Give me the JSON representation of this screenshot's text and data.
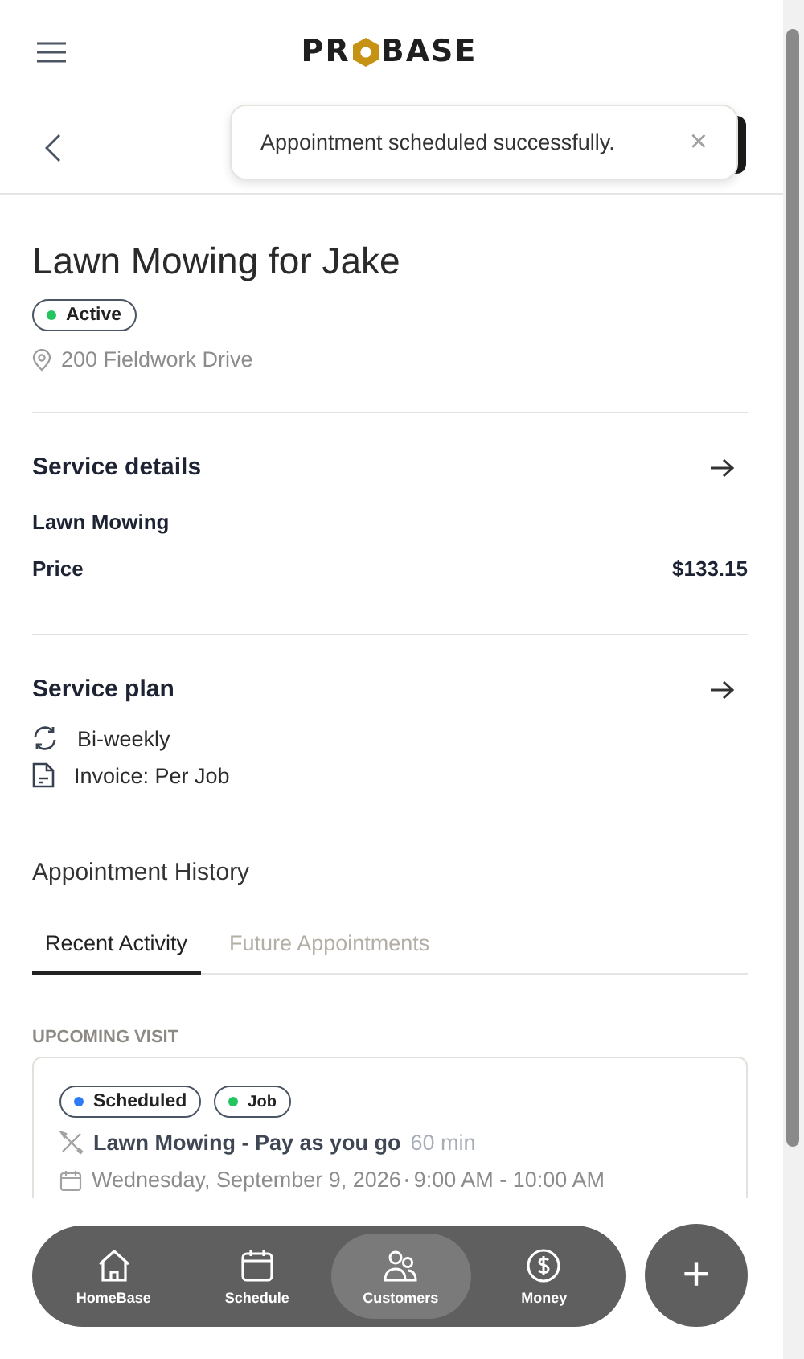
{
  "header": {
    "logo_left": "PR",
    "logo_right": "BASE"
  },
  "toast": {
    "message": "Appointment scheduled successfully.",
    "close": "×"
  },
  "job": {
    "title": "Lawn Mowing for Jake",
    "status": {
      "label": "Active",
      "color": "#22c55e"
    },
    "address": "200 Fieldwork Drive"
  },
  "service_details": {
    "heading": "Service details",
    "service": "Lawn Mowing",
    "price_label": "Price",
    "price": "$133.15"
  },
  "service_plan": {
    "heading": "Service plan",
    "items": [
      {
        "kind": "repeat",
        "text": "Bi-weekly"
      },
      {
        "kind": "invoice",
        "text": "Invoice: Per Job"
      }
    ]
  },
  "history": {
    "heading": "Appointment History",
    "tabs": [
      {
        "label": "Recent Activity",
        "selected": true
      },
      {
        "label": "Future Appointments",
        "selected": false
      }
    ]
  },
  "upcoming": {
    "label": "UPCOMING VISIT",
    "tags": [
      {
        "label": "Scheduled",
        "color": "#2f7bf6"
      },
      {
        "label": "Job",
        "color": "#22c55e"
      }
    ],
    "service": "Lawn Mowing - Pay as you go",
    "duration": "60 min",
    "date": "Wednesday, September 9, 2026",
    "time": "9:00 AM - 10:00 AM"
  },
  "nav": [
    {
      "kind": "home",
      "label": "HomeBase",
      "selected": false
    },
    {
      "kind": "calendar",
      "label": "Schedule",
      "selected": false
    },
    {
      "kind": "people",
      "label": "Customers",
      "selected": true
    },
    {
      "kind": "money",
      "label": "Money",
      "selected": false
    }
  ],
  "fab": {
    "label": "+"
  }
}
